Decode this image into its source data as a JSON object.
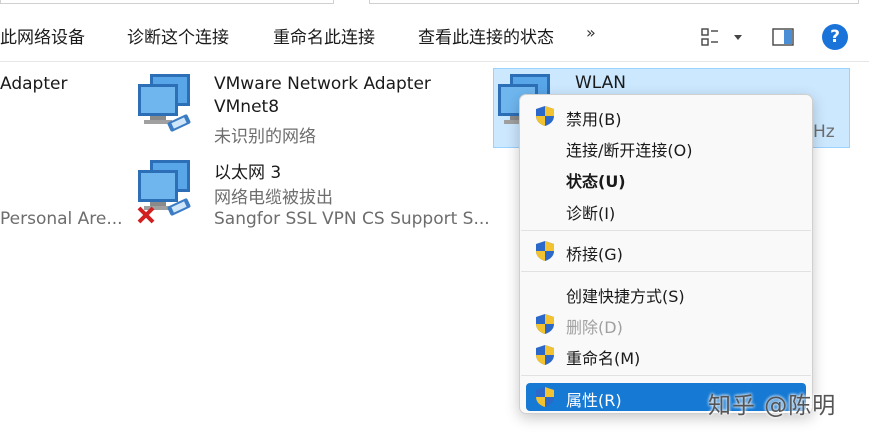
{
  "toolbar": {
    "items": [
      {
        "label": "此网络设备"
      },
      {
        "label": "诊断这个连接"
      },
      {
        "label": "重命名此连接"
      },
      {
        "label": "查看此连接的状态"
      }
    ],
    "more": "»",
    "view_icon": "view-options-icon",
    "pane_icon": "preview-pane-icon",
    "help_label": "?"
  },
  "adapters": [
    {
      "name": "Adapter",
      "status": "",
      "device": "Personal Are..."
    },
    {
      "name": "VMware Network Adapter VMnet8",
      "name_line1": "VMware Network Adapter",
      "name_line2": "VMnet8",
      "status": "未识别的网络",
      "device": ""
    },
    {
      "name": "以太网 3",
      "status": "网络电缆被拔出",
      "device": "Sangfor SSL VPN CS Support S..."
    },
    {
      "name": "WLAN",
      "status": "",
      "device": "Hz"
    }
  ],
  "context_menu": {
    "items": [
      {
        "label": "禁用(B)",
        "shield": true
      },
      {
        "label": "连接/断开连接(O)",
        "shield": false
      },
      {
        "label": "状态(U)",
        "shield": false,
        "bold": true
      },
      {
        "label": "诊断(I)",
        "shield": false
      },
      {
        "label": "桥接(G)",
        "shield": true
      },
      {
        "label": "创建快捷方式(S)",
        "shield": false
      },
      {
        "label": "删除(D)",
        "shield": true,
        "disabled": true
      },
      {
        "label": "重命名(M)",
        "shield": true
      },
      {
        "label": "属性(R)",
        "shield": true,
        "highlighted": true
      }
    ]
  },
  "watermark": "知乎 @陈明",
  "colors": {
    "selection_bg": "#cce8ff",
    "menu_highlight": "#1679d3",
    "help_blue": "#1a73d9"
  }
}
